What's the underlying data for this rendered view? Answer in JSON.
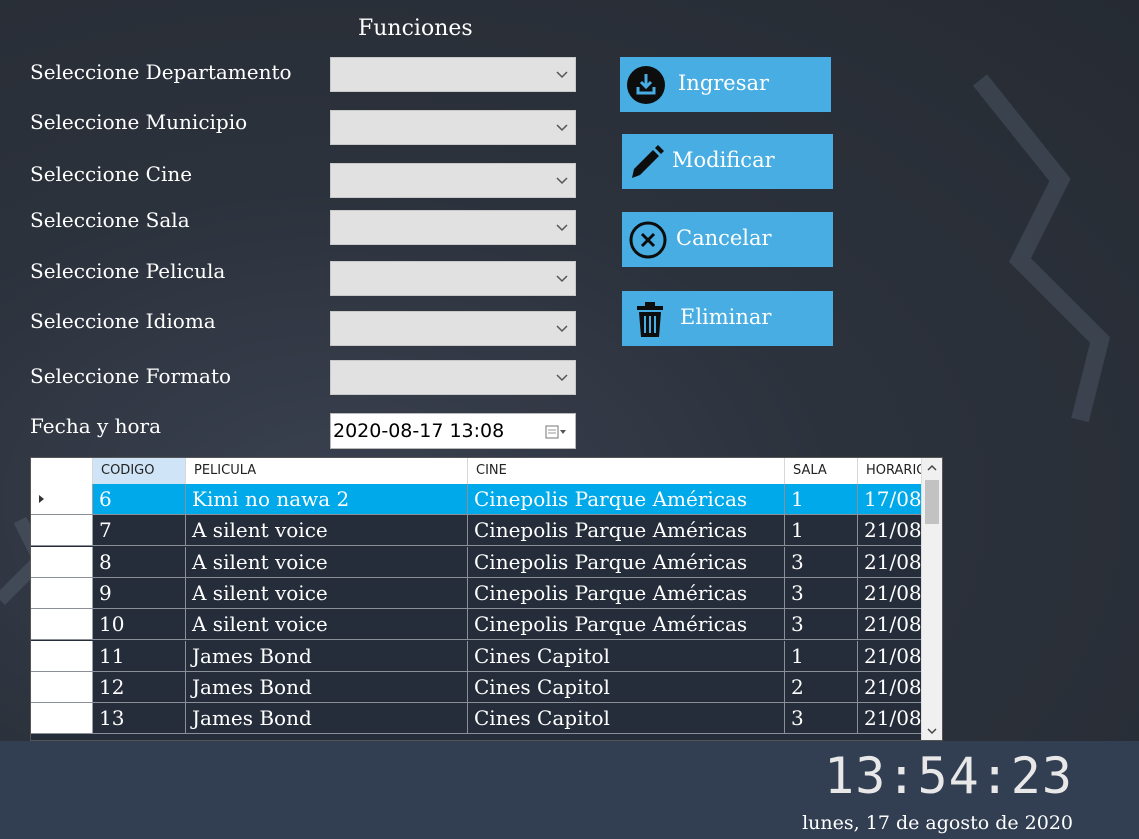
{
  "form": {
    "title": "Funciones",
    "labels": {
      "departamento": "Seleccione Departamento",
      "municipio": "Seleccione Municipio",
      "cine": "Seleccione Cine",
      "sala": "Seleccione Sala",
      "pelicula": "Seleccione Pelicula",
      "idioma": "Seleccione Idioma",
      "formato": "Seleccione Formato",
      "fecha": "Fecha y hora"
    },
    "fecha_value": "2020-08-17 13:08"
  },
  "buttons": {
    "ingresar": "Ingresar",
    "modificar": "Modificar",
    "cancelar": "Cancelar",
    "eliminar": "Eliminar"
  },
  "grid": {
    "columns": [
      "CODIGO",
      "PELICULA",
      "CINE",
      "SALA",
      "HORARIO"
    ],
    "rows": [
      {
        "codigo": "6",
        "pelicula": "Kimi no nawa 2",
        "cine": "Cinepolis Parque Américas",
        "sala": "1",
        "horario": "17/08"
      },
      {
        "codigo": "7",
        "pelicula": "A silent voice",
        "cine": "Cinepolis Parque Américas",
        "sala": "1",
        "horario": "21/08"
      },
      {
        "codigo": "8",
        "pelicula": "A silent voice",
        "cine": "Cinepolis Parque Américas",
        "sala": "3",
        "horario": "21/08"
      },
      {
        "codigo": "9",
        "pelicula": "A silent voice",
        "cine": "Cinepolis Parque Américas",
        "sala": "3",
        "horario": "21/08"
      },
      {
        "codigo": "10",
        "pelicula": "A silent voice",
        "cine": "Cinepolis Parque Américas",
        "sala": "3",
        "horario": "21/08"
      },
      {
        "codigo": "11",
        "pelicula": "James Bond",
        "cine": "Cines Capitol",
        "sala": "1",
        "horario": "21/08"
      },
      {
        "codigo": "12",
        "pelicula": "James Bond",
        "cine": "Cines Capitol",
        "sala": "2",
        "horario": "21/08"
      },
      {
        "codigo": "13",
        "pelicula": "James Bond",
        "cine": "Cines Capitol",
        "sala": "3",
        "horario": "21/08"
      }
    ],
    "selected_index": 0
  },
  "footer": {
    "time": "13:54:23",
    "date": "lunes, 17 de agosto de 2020"
  },
  "colors": {
    "accent": "#47ade2",
    "selected_row": "#00a9e9",
    "footer_bg": "#323f52"
  }
}
